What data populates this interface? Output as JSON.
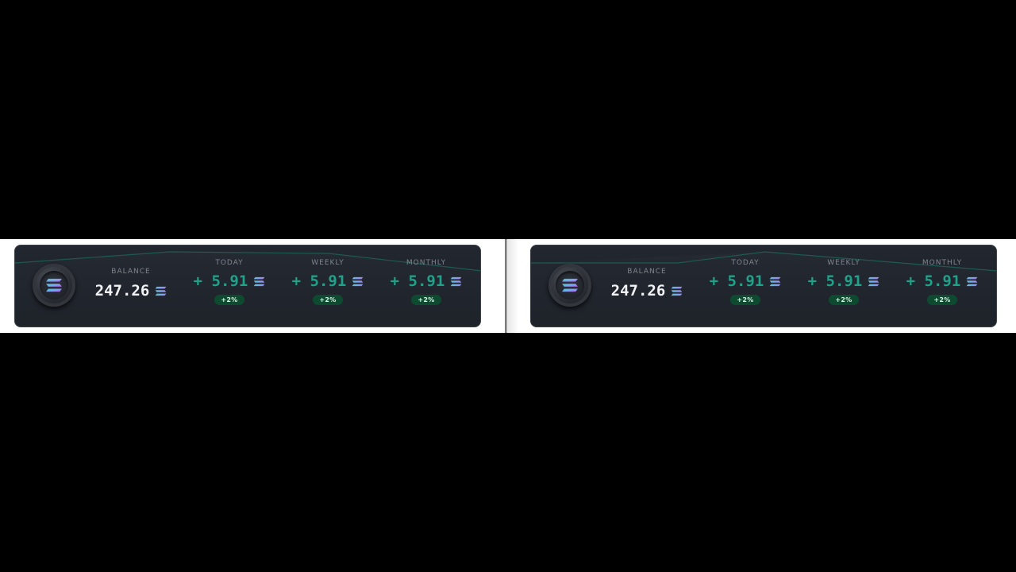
{
  "colors": {
    "card_background": "#1d2129",
    "positive": "#1fa18a",
    "badge_background": "#0e4a2f",
    "label": "#7e8590",
    "sol_gradient_start": "#9b5cf6",
    "sol_gradient_end": "#2fd5c4"
  },
  "icons": {
    "coin": "solana-coin-icon",
    "currency": "solana-logo-icon"
  },
  "panels": [
    {
      "balance_label": "BALANCE",
      "balance_value": "247.26",
      "stats": [
        {
          "label": "TODAY",
          "value": "+ 5.91",
          "change": "+2%"
        },
        {
          "label": "WEEKLY",
          "value": "+ 5.91",
          "change": "+2%"
        },
        {
          "label": "MONTHLY",
          "value": "+ 5.91",
          "change": "+2%"
        }
      ]
    },
    {
      "balance_label": "BALANCE",
      "balance_value": "247.26",
      "stats": [
        {
          "label": "TODAY",
          "value": "+ 5.91",
          "change": "+2%"
        },
        {
          "label": "WEEKLY",
          "value": "+ 5.91",
          "change": "+2%"
        },
        {
          "label": "MONTHLY",
          "value": "+ 5.91",
          "change": "+2%"
        }
      ]
    }
  ]
}
